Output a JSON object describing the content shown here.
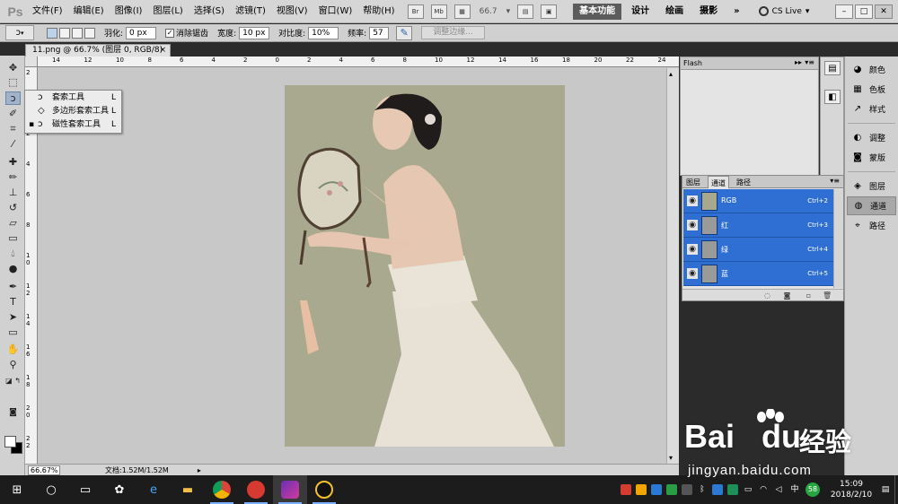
{
  "menubar": {
    "logo": "Ps",
    "items": [
      "文件(F)",
      "编辑(E)",
      "图像(I)",
      "图层(L)",
      "选择(S)",
      "滤镜(T)",
      "视图(V)",
      "窗口(W)",
      "帮助(H)"
    ],
    "icons": [
      "bridge-icon",
      "minibridge-icon",
      "extras-icon",
      "zoom-icon",
      "arrange-icon",
      "screen-mode-icon"
    ],
    "zoom": "66.7",
    "workspaces": [
      "基本功能",
      "设计",
      "绘画",
      "摄影"
    ],
    "active_workspace": "基本功能",
    "more": "»",
    "cslive": "CS Live",
    "window_controls": [
      "–",
      "□",
      "✕"
    ]
  },
  "options": {
    "feather_label": "羽化:",
    "feather_value": "0 px",
    "antialias_label": "消除锯齿",
    "antialias_checked": "✓",
    "width_label": "宽度:",
    "width_value": "10 px",
    "contrast_label": "对比度:",
    "contrast_value": "10%",
    "frequency_label": "频率:",
    "frequency_value": "57",
    "refine_edge": "调整边缘..."
  },
  "document": {
    "tab_title": "11.png @ 66.7% (图层 0, RGB/8)",
    "tab_close": "×",
    "ruler_h": [
      "14",
      "12",
      "10",
      "8",
      "6",
      "4",
      "2",
      "0",
      "2",
      "4",
      "6",
      "8",
      "10",
      "12",
      "14",
      "16",
      "18",
      "20",
      "22",
      "24"
    ],
    "ruler_v": [
      "2",
      "0",
      "2",
      "4",
      "6",
      "8",
      "1\n0",
      "1\n2",
      "1\n4",
      "1\n6",
      "1\n8",
      "2\n0",
      "2\n2",
      "2\n4"
    ],
    "zoom": "66.67%",
    "doc_size": "文档:1.52M/1.52M",
    "status_arrow": "▸"
  },
  "flyout": {
    "items": [
      {
        "label": "套索工具",
        "key": "L",
        "icon": "lasso-icon",
        "selected": false
      },
      {
        "label": "多边形套索工具",
        "key": "L",
        "icon": "polygonal-lasso-icon",
        "selected": false
      },
      {
        "label": "磁性套索工具",
        "key": "L",
        "icon": "magnetic-lasso-icon",
        "selected": true
      }
    ],
    "bullet": "▪"
  },
  "flash_panel": {
    "tab": "Flash",
    "collapse": "▸▸",
    "menu": "▾≡"
  },
  "channels_panel": {
    "tabs": [
      "图层",
      "通道",
      "路径"
    ],
    "active_tab": "通道",
    "menu": "▾≡",
    "rows": [
      {
        "name": "RGB",
        "shortcut": "Ctrl+2"
      },
      {
        "name": "红",
        "shortcut": "Ctrl+3"
      },
      {
        "name": "绿",
        "shortcut": "Ctrl+4"
      },
      {
        "name": "蓝",
        "shortcut": "Ctrl+5"
      }
    ],
    "eye": "◉"
  },
  "dock": {
    "items": [
      {
        "label": "颜色",
        "icon": "color-icon"
      },
      {
        "label": "色板",
        "icon": "swatches-icon"
      },
      {
        "label": "样式",
        "icon": "styles-icon"
      },
      {
        "label": "调整",
        "icon": "adjustments-icon"
      },
      {
        "label": "蒙版",
        "icon": "masks-icon"
      },
      {
        "label": "图层",
        "icon": "layers-icon"
      },
      {
        "label": "通道",
        "icon": "channels-icon"
      },
      {
        "label": "路径",
        "icon": "paths-icon"
      }
    ],
    "active": "通道"
  },
  "watermark": {
    "brand": "Bai",
    "brand2": "du",
    "jingyan": "经验",
    "url": "jingyan.baidu.com"
  },
  "taskbar": {
    "time": "15:09",
    "date": "2018/2/10",
    "ime": "中",
    "badge": "58"
  },
  "colors": {
    "channel_selected": "#2f6fd3",
    "workspace_active": "#5c5c5c",
    "photo_bg": "#a8a88f"
  }
}
